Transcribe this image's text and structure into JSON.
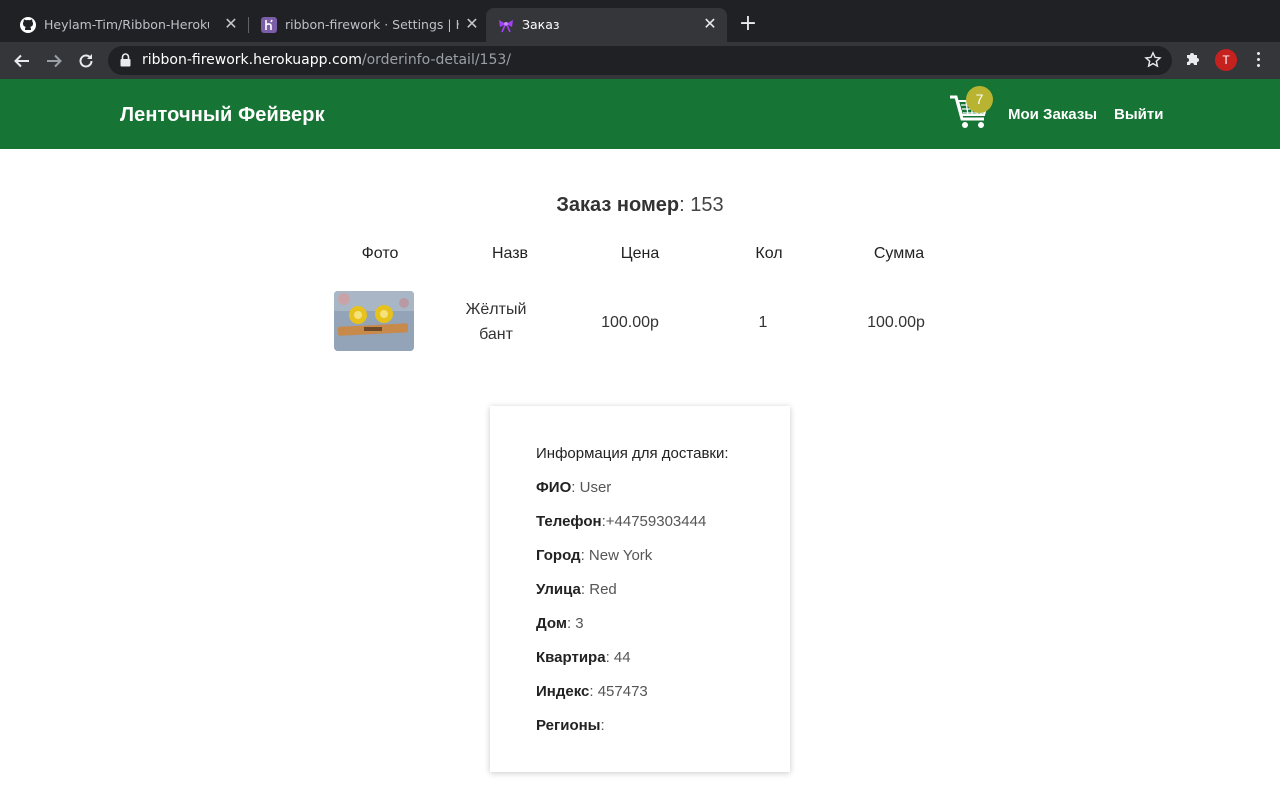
{
  "browser": {
    "tabs": [
      {
        "title": "Heylam-Tim/Ribbon-Heroku",
        "icon": "github-icon",
        "active": false
      },
      {
        "title": "ribbon-firework · Settings | Her",
        "icon": "heroku-icon",
        "active": false
      },
      {
        "title": "Заказ",
        "icon": "ribbon-icon",
        "active": true
      }
    ],
    "url_host": "ribbon-firework.herokuapp.com",
    "url_path": "/orderinfo-detail/153/",
    "profile_initial": "T"
  },
  "header": {
    "brand": "Ленточный Фейверк",
    "cart_count": "7",
    "nav": {
      "orders": "Мои Заказы",
      "logout": "Выйти"
    }
  },
  "order": {
    "title_label": "Заказ номер",
    "number": "153",
    "columns": [
      "Фото",
      "Назв",
      "Цена",
      "Кол",
      "Сумма"
    ],
    "items": [
      {
        "name_line1": "Жёлтый",
        "name_line2": "бант",
        "price": "100.00р",
        "qty": "1",
        "sum": "100.00р"
      }
    ]
  },
  "delivery": {
    "heading": "Информация для доставки:",
    "fields": [
      {
        "label": "ФИО",
        "sep": ": ",
        "value": "User"
      },
      {
        "label": "Телефон",
        "sep": ":",
        "value": "+44759303444"
      },
      {
        "label": "Город",
        "sep": ": ",
        "value": "New York"
      },
      {
        "label": "Улица",
        "sep": ": ",
        "value": "Red"
      },
      {
        "label": "Дом",
        "sep": ": ",
        "value": "3"
      },
      {
        "label": "Квартира",
        "sep": ": ",
        "value": "44"
      },
      {
        "label": "Индекс",
        "sep": ": ",
        "value": "457473"
      },
      {
        "label": "Регионы",
        "sep": ":",
        "value": ""
      }
    ]
  },
  "colors": {
    "header_bg": "#167434",
    "badge": "#b8b432"
  }
}
